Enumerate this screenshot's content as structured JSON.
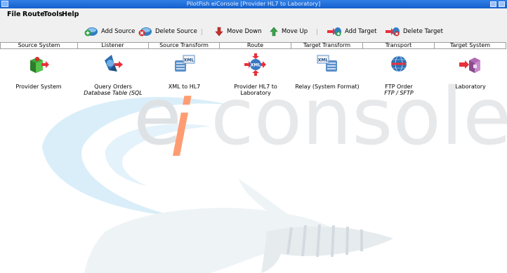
{
  "window": {
    "title": "PilotFish eiConsole [Provider HL7 to Laboratory]"
  },
  "menu": [
    "File",
    "Route",
    "Tools",
    "Help"
  ],
  "toolbar": {
    "add_source": "Add Source",
    "delete_source": "Delete Source",
    "move_down": "Move Down",
    "move_up": "Move Up",
    "add_target": "Add Target",
    "delete_target": "Delete Target"
  },
  "stages": [
    {
      "header": "Source System",
      "label": "Provider System",
      "sublabel": "",
      "icon": "source-system-icon"
    },
    {
      "header": "Listener",
      "label": "Query Orders",
      "sublabel": "Database Table (SQL",
      "icon": "listener-icon"
    },
    {
      "header": "Source Transform",
      "label": "XML to HL7",
      "sublabel": "",
      "icon": "xml-transform-icon"
    },
    {
      "header": "Route",
      "label": "Provider HL7 to Laboratory",
      "sublabel": "",
      "icon": "route-icon"
    },
    {
      "header": "Target Transform",
      "label": "Relay (System Format)",
      "sublabel": "",
      "icon": "xml-transform-icon"
    },
    {
      "header": "Transport",
      "label": "FTP Order",
      "sublabel": "FTP / SFTP",
      "icon": "globe-icon"
    },
    {
      "header": "Target System",
      "label": "Laboratory",
      "sublabel": "",
      "icon": "target-system-icon"
    }
  ],
  "watermark": {
    "text": "eiconsole",
    "colors": {
      "e": "#dfe2e5",
      "i": "#ff9a6e",
      "rest": "#e6e8ea",
      "swoosh": "#d2eaf8",
      "fish": "#eef2f4"
    }
  },
  "colors": {
    "titlebar": "#1f6fd8",
    "chrome": "#f0f0f0",
    "arrow_red": "#e8303a"
  }
}
